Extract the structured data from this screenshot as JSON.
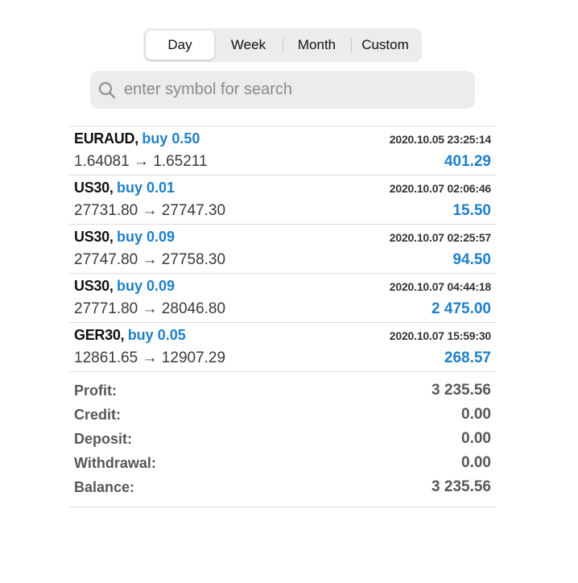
{
  "period_tabs": [
    {
      "label": "Day",
      "active": true
    },
    {
      "label": "Week",
      "active": false
    },
    {
      "label": "Month",
      "active": false
    },
    {
      "label": "Custom",
      "active": false
    }
  ],
  "search": {
    "icon": "search-icon",
    "placeholder": "enter symbol for search"
  },
  "colors": {
    "accent_blue": "#1f80c8",
    "summary_gray": "#55575b"
  },
  "deals": [
    {
      "symbol": "EURAUD,",
      "side": "buy 0.50",
      "time": "2020.10.05 23:25:14",
      "prices": "1.64081 → 1.65211",
      "profit": "401.29"
    },
    {
      "symbol": "US30,",
      "side": "buy 0.01",
      "time": "2020.10.07 02:06:46",
      "prices": "27731.80 → 27747.30",
      "profit": "15.50"
    },
    {
      "symbol": "US30,",
      "side": "buy 0.09",
      "time": "2020.10.07 02:25:57",
      "prices": "27747.80 → 27758.30",
      "profit": "94.50"
    },
    {
      "symbol": "US30,",
      "side": "buy 0.09",
      "time": "2020.10.07 04:44:18",
      "prices": "27771.80 → 28046.80",
      "profit": "2 475.00"
    },
    {
      "symbol": "GER30,",
      "side": "buy 0.05",
      "time": "2020.10.07 15:59:30",
      "prices": "12861.65 → 12907.29",
      "profit": "268.57"
    }
  ],
  "summary": [
    {
      "label": "Profit:",
      "value": "3 235.56"
    },
    {
      "label": "Credit:",
      "value": "0.00"
    },
    {
      "label": "Deposit:",
      "value": "0.00"
    },
    {
      "label": "Withdrawal:",
      "value": "0.00"
    },
    {
      "label": "Balance:",
      "value": "3 235.56"
    }
  ]
}
